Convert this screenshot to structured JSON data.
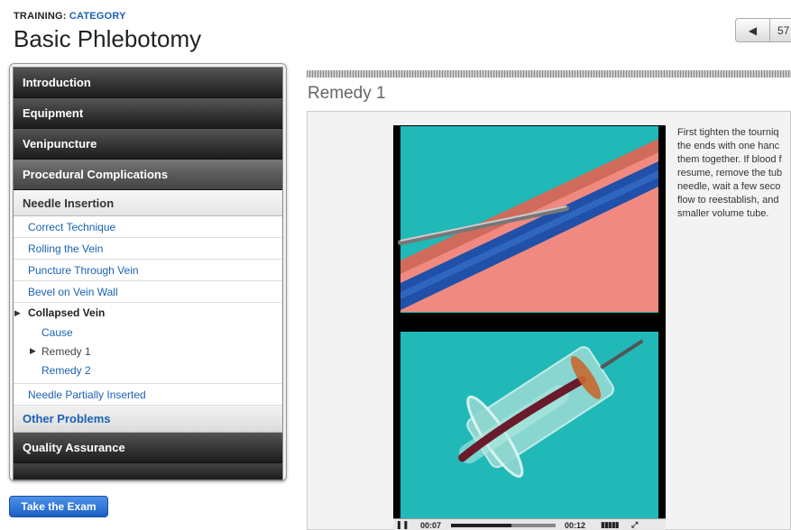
{
  "header": {
    "crumb_prefix": "TRAINING: ",
    "crumb_category": "CATEGORY",
    "title": "Basic Phlebotomy",
    "pager_prev_icon": "left-arrow-icon",
    "page_number": "57"
  },
  "sidebar": {
    "sections": [
      "Introduction",
      "Equipment",
      "Venipuncture",
      "Procedural Complications"
    ],
    "sub_header": "Needle Insertion",
    "links": [
      "Correct Technique",
      "Rolling the Vein",
      "Puncture Through Vein",
      "Bevel on Vein Wall"
    ],
    "current": "Collapsed Vein",
    "children": [
      "Cause",
      "Remedy 1",
      "Remedy 2"
    ],
    "link_after": "Needle Partially Inserted",
    "other": "Other Problems",
    "quality": "Quality Assurance"
  },
  "exam_button": "Take the Exam",
  "content": {
    "section_title": "Remedy 1",
    "description_lines": [
      "First tighten the tourniq",
      "the ends with one hanc",
      "them together. If blood f",
      "resume, remove the tub",
      "needle, wait a few seco",
      "flow to reestablish, and",
      "smaller volume tube."
    ],
    "video": {
      "elapsed": "00:07",
      "duration": "00:12",
      "progress": 0.58
    }
  },
  "colors": {
    "accent_link": "#1a62b4",
    "menu_dark": "#2a2a2a",
    "video_bg_teal": "#21b8b8",
    "vein_blue": "#2050a8",
    "tissue_pink": "#f08a80"
  }
}
